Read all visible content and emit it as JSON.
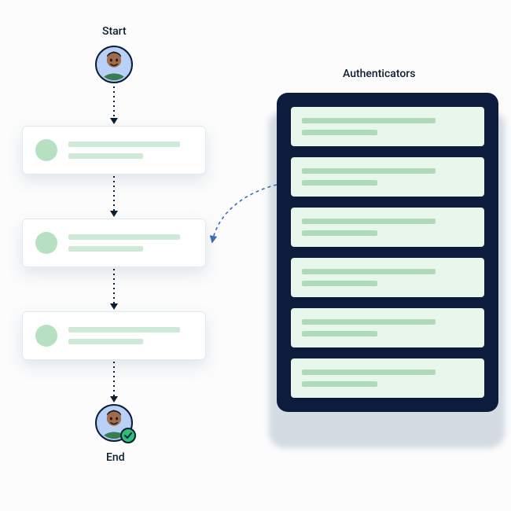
{
  "labels": {
    "start": "Start",
    "end": "End",
    "authenticators": "Authenticators"
  },
  "colors": {
    "panel_bg": "#0d1b3d",
    "card_bg": "#ffffff",
    "auth_item_bg": "#e9f6ec",
    "accent_green": "#2dbf7a",
    "placeholder_green": "#aedab9",
    "placeholder_green_light": "#cfe9d7",
    "ink": "#0a1f33"
  },
  "flow_steps": 3,
  "authenticator_count": 6
}
